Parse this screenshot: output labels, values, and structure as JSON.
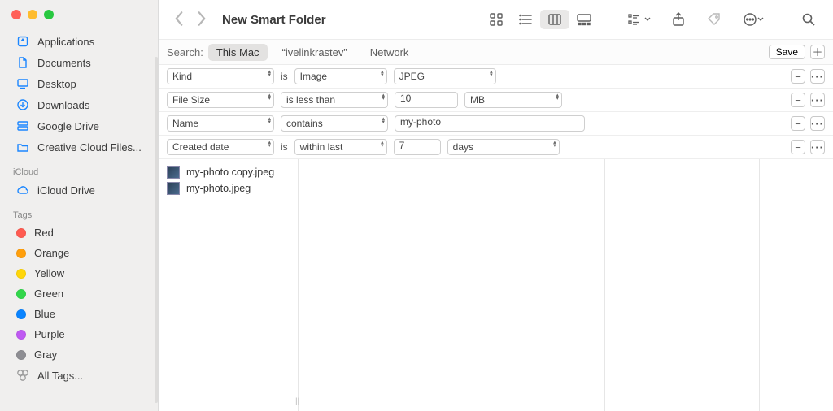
{
  "window": {
    "title": "New Smart Folder"
  },
  "sidebar": {
    "favorites": [
      {
        "label": "Applications",
        "icon": "apps"
      },
      {
        "label": "Documents",
        "icon": "doc"
      },
      {
        "label": "Desktop",
        "icon": "desktop"
      },
      {
        "label": "Downloads",
        "icon": "downloads"
      },
      {
        "label": "Google Drive",
        "icon": "drive"
      },
      {
        "label": "Creative Cloud Files...",
        "icon": "folder"
      }
    ],
    "icloud_head": "iCloud",
    "icloud": [
      {
        "label": "iCloud Drive",
        "icon": "cloud"
      }
    ],
    "tags_head": "Tags",
    "tags": [
      {
        "label": "Red",
        "color": "#ff5b51"
      },
      {
        "label": "Orange",
        "color": "#ff9f0c"
      },
      {
        "label": "Yellow",
        "color": "#ffd60a"
      },
      {
        "label": "Green",
        "color": "#32d74b"
      },
      {
        "label": "Blue",
        "color": "#0a84ff"
      },
      {
        "label": "Purple",
        "color": "#bf5af2"
      },
      {
        "label": "Gray",
        "color": "#8e8e93"
      }
    ],
    "all_tags": "All Tags..."
  },
  "search": {
    "label": "Search:",
    "scopes": [
      "This Mac",
      "“ivelinkrastev”",
      "Network"
    ],
    "active_scope": 0,
    "save": "Save"
  },
  "criteria": [
    {
      "left": "Kind",
      "mid_txt": "is",
      "mid_sel": "Image",
      "right_sel": "JPEG",
      "widths": [
        132,
        114,
        126
      ]
    },
    {
      "left": "File Size",
      "mid_sel": "is less than",
      "input": "10",
      "right_sel": "MB",
      "widths": [
        132,
        132,
        78,
        120
      ]
    },
    {
      "left": "Name",
      "mid_sel": "contains",
      "input": "my-photo",
      "widths": [
        132,
        132,
        234
      ]
    },
    {
      "left": "Created date",
      "mid_txt": "is",
      "mid_sel": "within last",
      "input": "7",
      "right_sel": "days",
      "widths": [
        132,
        114,
        58,
        138
      ]
    }
  ],
  "results": [
    {
      "name": "my-photo copy.jpeg"
    },
    {
      "name": "my-photo.jpeg"
    }
  ]
}
